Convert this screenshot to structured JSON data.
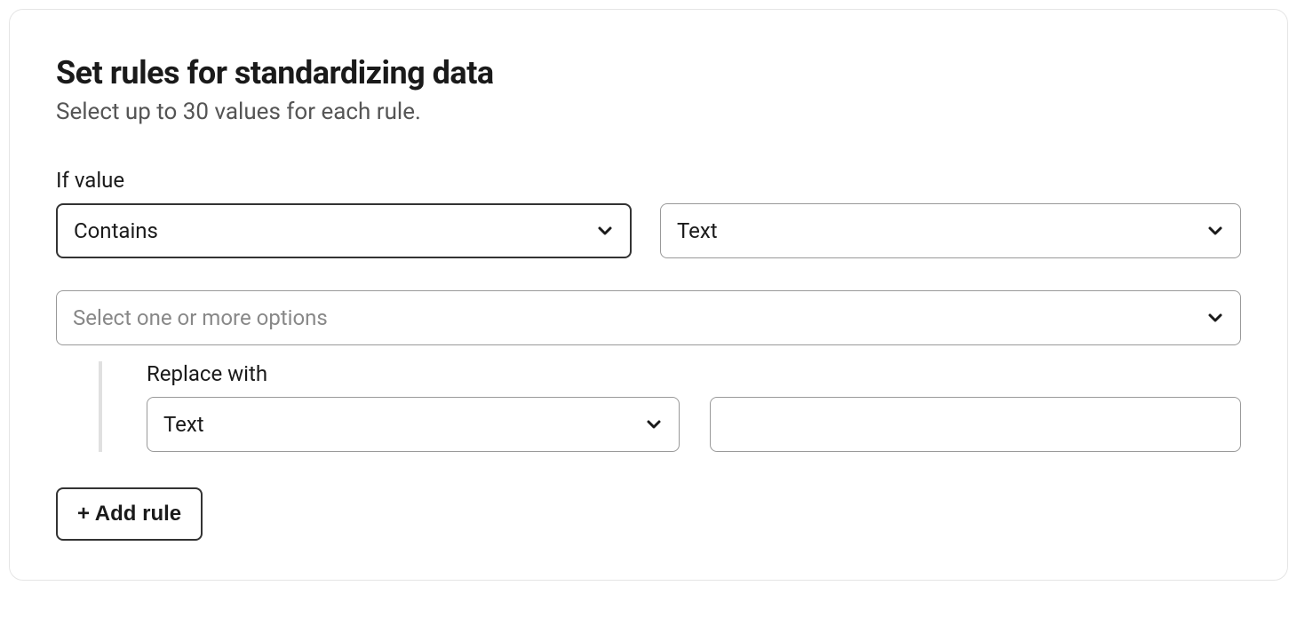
{
  "header": {
    "title": "Set rules for standardizing data",
    "subtitle": "Select up to 30 values for each rule."
  },
  "rule": {
    "if_value_label": "If value",
    "condition_selected": "Contains",
    "type_selected": "Text",
    "multiselect_placeholder": "Select one or more options",
    "replace_with_label": "Replace with",
    "replace_type_selected": "Text",
    "replace_value": ""
  },
  "buttons": {
    "add_rule": "+ Add rule"
  }
}
